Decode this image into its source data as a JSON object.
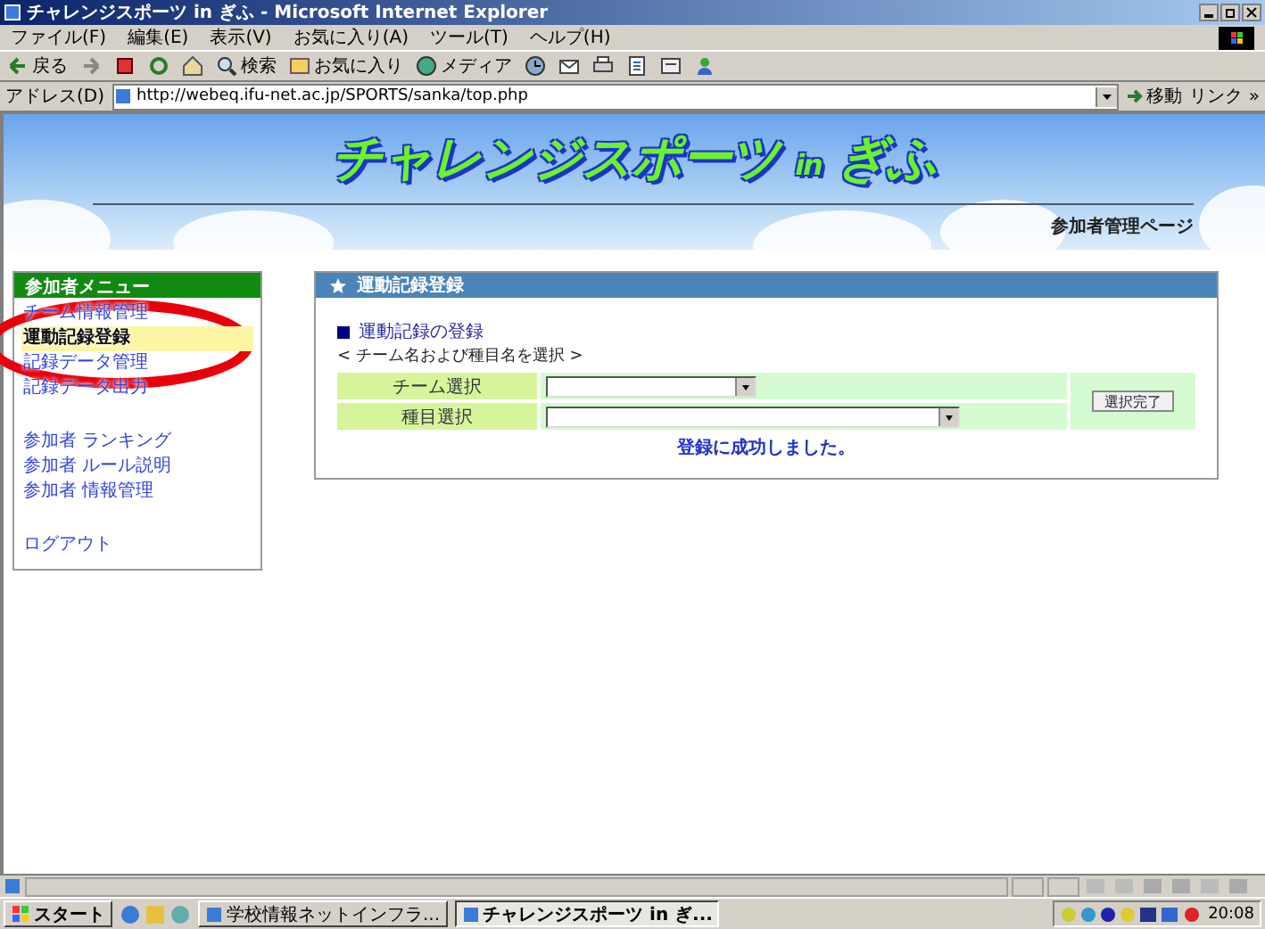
{
  "window": {
    "title": "チャレンジスポーツ in ぎふ - Microsoft Internet Explorer"
  },
  "menu": [
    "ファイル(F)",
    "編集(E)",
    "表示(V)",
    "お気に入り(A)",
    "ツール(T)",
    "ヘルプ(H)"
  ],
  "toolbar": [
    {
      "kind": "back",
      "label": "戻る"
    },
    {
      "kind": "forward"
    },
    {
      "kind": "stop"
    },
    {
      "kind": "refresh"
    },
    {
      "kind": "home"
    },
    {
      "kind": "search",
      "label": "検索"
    },
    {
      "kind": "favorites",
      "label": "お気に入り"
    },
    {
      "kind": "media",
      "label": "メディア"
    },
    {
      "kind": "history"
    },
    {
      "kind": "mail"
    },
    {
      "kind": "print"
    },
    {
      "kind": "edit"
    },
    {
      "kind": "discuss"
    },
    {
      "kind": "messenger"
    }
  ],
  "address": {
    "label": "アドレス(D)",
    "url": "http://webeq.ifu-net.ac.jp/SPORTS/sanka/top.php",
    "go": "移動",
    "links": "リンク »"
  },
  "banner": {
    "logo_main": "チャレンジスポーツ",
    "logo_small": "in",
    "logo_place": "ぎふ",
    "subtitle": "参加者管理ページ"
  },
  "sidebar": {
    "title": "参加者メニュー",
    "groups": [
      [
        {
          "label": "チーム情報管理",
          "selected": false
        },
        {
          "label": "運動記録登録",
          "selected": true
        },
        {
          "label": "記録データ管理",
          "selected": false
        },
        {
          "label": "記録データ出力",
          "selected": false
        }
      ],
      [
        {
          "label": "参加者 ランキング",
          "selected": false
        },
        {
          "label": "参加者 ルール説明",
          "selected": false
        },
        {
          "label": "参加者 情報管理",
          "selected": false
        }
      ],
      [
        {
          "label": "ログアウト",
          "selected": false
        }
      ]
    ]
  },
  "annotation": {
    "kind": "ellipse",
    "color": "#e8000b"
  },
  "panel": {
    "title": "運動記録登録",
    "section": "運動記録の登録",
    "hint": "< チーム名および種目名を選択 >",
    "fields": [
      {
        "label": "チーム選択",
        "kind": "short"
      },
      {
        "label": "種目選択",
        "kind": "long"
      }
    ],
    "button": "選択完了",
    "message": "登録に成功しました。"
  },
  "taskbar": {
    "start": "スタート",
    "tasks": [
      {
        "label": "学校情報ネットインフラ...",
        "selected": false
      },
      {
        "label": "チャレンジスポーツ in ぎ...",
        "selected": true
      }
    ],
    "clock": "20:08"
  }
}
